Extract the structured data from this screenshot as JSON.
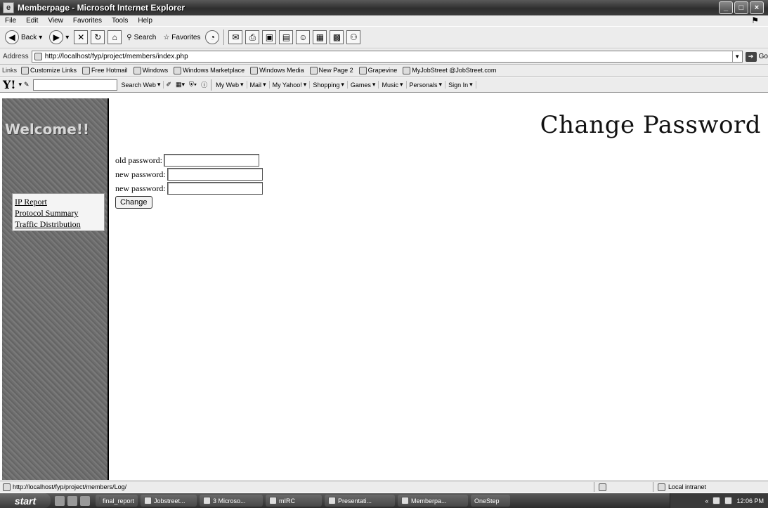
{
  "window": {
    "title": "Memberpage - Microsoft Internet Explorer"
  },
  "menu": [
    "File",
    "Edit",
    "View",
    "Favorites",
    "Tools",
    "Help"
  ],
  "toolbar": {
    "back_label": "Back",
    "search_label": "Search",
    "favorites_label": "Favorites"
  },
  "address": {
    "label": "Address",
    "url": "http://localhost/fyp/project/members/index.php",
    "go_label": "Go"
  },
  "links": {
    "label": "Links",
    "items": [
      "Customize Links",
      "Free Hotmail",
      "Windows",
      "Windows Marketplace",
      "Windows Media",
      "New Page 2",
      "Grapevine",
      "MyJobStreet @JobStreet.com"
    ]
  },
  "yahoo": {
    "search_label": "Search Web",
    "items": [
      "My Web",
      "Mail",
      "My Yahoo!",
      "Shopping",
      "Games",
      "Music",
      "Personals",
      "Sign In"
    ]
  },
  "sidebar": {
    "welcome": "Welcome!!",
    "menu": [
      "IP Report",
      "Protocol Summary",
      "Traffic Distribution"
    ]
  },
  "main": {
    "title": "Change Password",
    "old_label": "old password:",
    "new_label": "new password:",
    "new2_label": "new password:",
    "button": "Change"
  },
  "status": {
    "text": "http://localhost/fyp/project/members/Log/",
    "zone": "Local intranet"
  },
  "taskbar": {
    "start": "start",
    "tasks": [
      "final_report",
      "Jobstreet...",
      "3 Microso...",
      "mIRC",
      "Presentati...",
      "Memberpa...",
      "OneStep"
    ],
    "clock": "12:06 PM"
  }
}
